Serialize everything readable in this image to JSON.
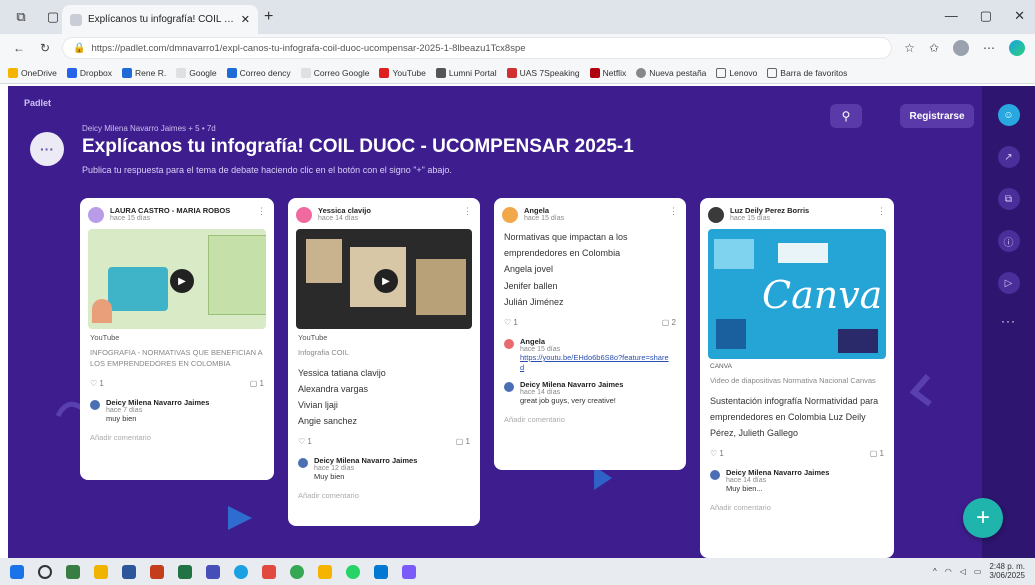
{
  "browser": {
    "tab_title": "Explícanos tu infografía! COIL DU",
    "url": "https://padlet.com/dmnavarro1/expl-canos-tu-infografa-coil-duoc-ucompensar-2025-1-8lbeazu1Tcx8spe",
    "bookmarks": [
      "OneDrive",
      "Dropbox",
      "Rene R.",
      "Google",
      "Correo dency",
      "Correo Google",
      "YouTube",
      "Lumni Portal",
      "UAS 7Speaking",
      "Netflix",
      "Nueva pestaña",
      "Lenovo",
      "Barra de favoritos"
    ]
  },
  "padlet": {
    "logo": "Padlet",
    "author_line": "Deicy Milena Navarro Jaimes + 5 • 7d",
    "title": "Explícanos tu infografía! COIL DUOC - UCOMPENSAR 2025-1",
    "subtitle": "Publica tu respuesta para el tema de debate haciendo clic en el botón con el signo \"+\" abajo.",
    "register_label": "Registrarse",
    "fab_label": "+"
  },
  "cards": [
    {
      "author": "LAURA CASTRO - MARIA ROBOS",
      "time": "hace 15 días",
      "source": "YouTube",
      "caption": "INFOGRAFIA - NORMATIVAS QUE BENEFICIAN A LOS EMPRENDEDORES EN COLOMBIA",
      "likes": "1",
      "comments": "1",
      "comment": {
        "name": "Deicy Milena Navarro Jaimes",
        "time": "hace 7 días",
        "text": "muy bien"
      },
      "add_comment": "Añadir comentario"
    },
    {
      "author": "Yessica clavijo",
      "time": "hace 14 días",
      "source": "YouTube",
      "caption": "Infografia COIL",
      "lines": [
        "Yessica tatiana clavijo",
        "Alexandra vargas",
        "Vivian ljaji",
        "Angie sanchez"
      ],
      "likes": "1",
      "comments": "1",
      "comment": {
        "name": "Deicy Milena Navarro Jaimes",
        "time": "hace 12 días",
        "text": "Muy bien"
      },
      "add_comment": "Añadir comentario"
    },
    {
      "author": "Angela",
      "time": "hace 15 días",
      "lines": [
        "Normativas que impactan a los emprendedores en Colombia",
        "Angela jovel",
        "Jenifer ballen",
        "Julián Jiménez"
      ],
      "likes": "1",
      "comments": "2",
      "comment1": {
        "name": "Angela",
        "time": "hace 15 días",
        "link": "https://youtu.be/EHdo6b6S8o?feature=shared"
      },
      "comment2": {
        "name": "Deicy Milena Navarro Jaimes",
        "time": "hace 14 días",
        "text": "great job guys, very creative!"
      },
      "add_comment": "Añadir comentario"
    },
    {
      "author": "Luz Deily Perez Borris",
      "time": "hace 15 días",
      "source": "CANVA",
      "thumb_text": "Canva",
      "caption": "Video de diapositivas Normativa Nacional Canvas",
      "lines": [
        "Sustentación infografía Normatividad para emprendedores en Colombia Luz Deily Pérez, Julieth Gallego"
      ],
      "likes": "1",
      "comments": "1",
      "comment": {
        "name": "Deicy Milena Navarro Jaimes",
        "time": "hace 14 días",
        "text": "Muy bien..."
      },
      "add_comment": "Añadir comentario"
    }
  ],
  "taskbar": {
    "time": "2:48 p. m.",
    "date": "3/06/2025"
  },
  "colors": {
    "padlet_bg": "#3e1e8e",
    "fab": "#1fb5ad",
    "accent": "#5a3aa8"
  }
}
